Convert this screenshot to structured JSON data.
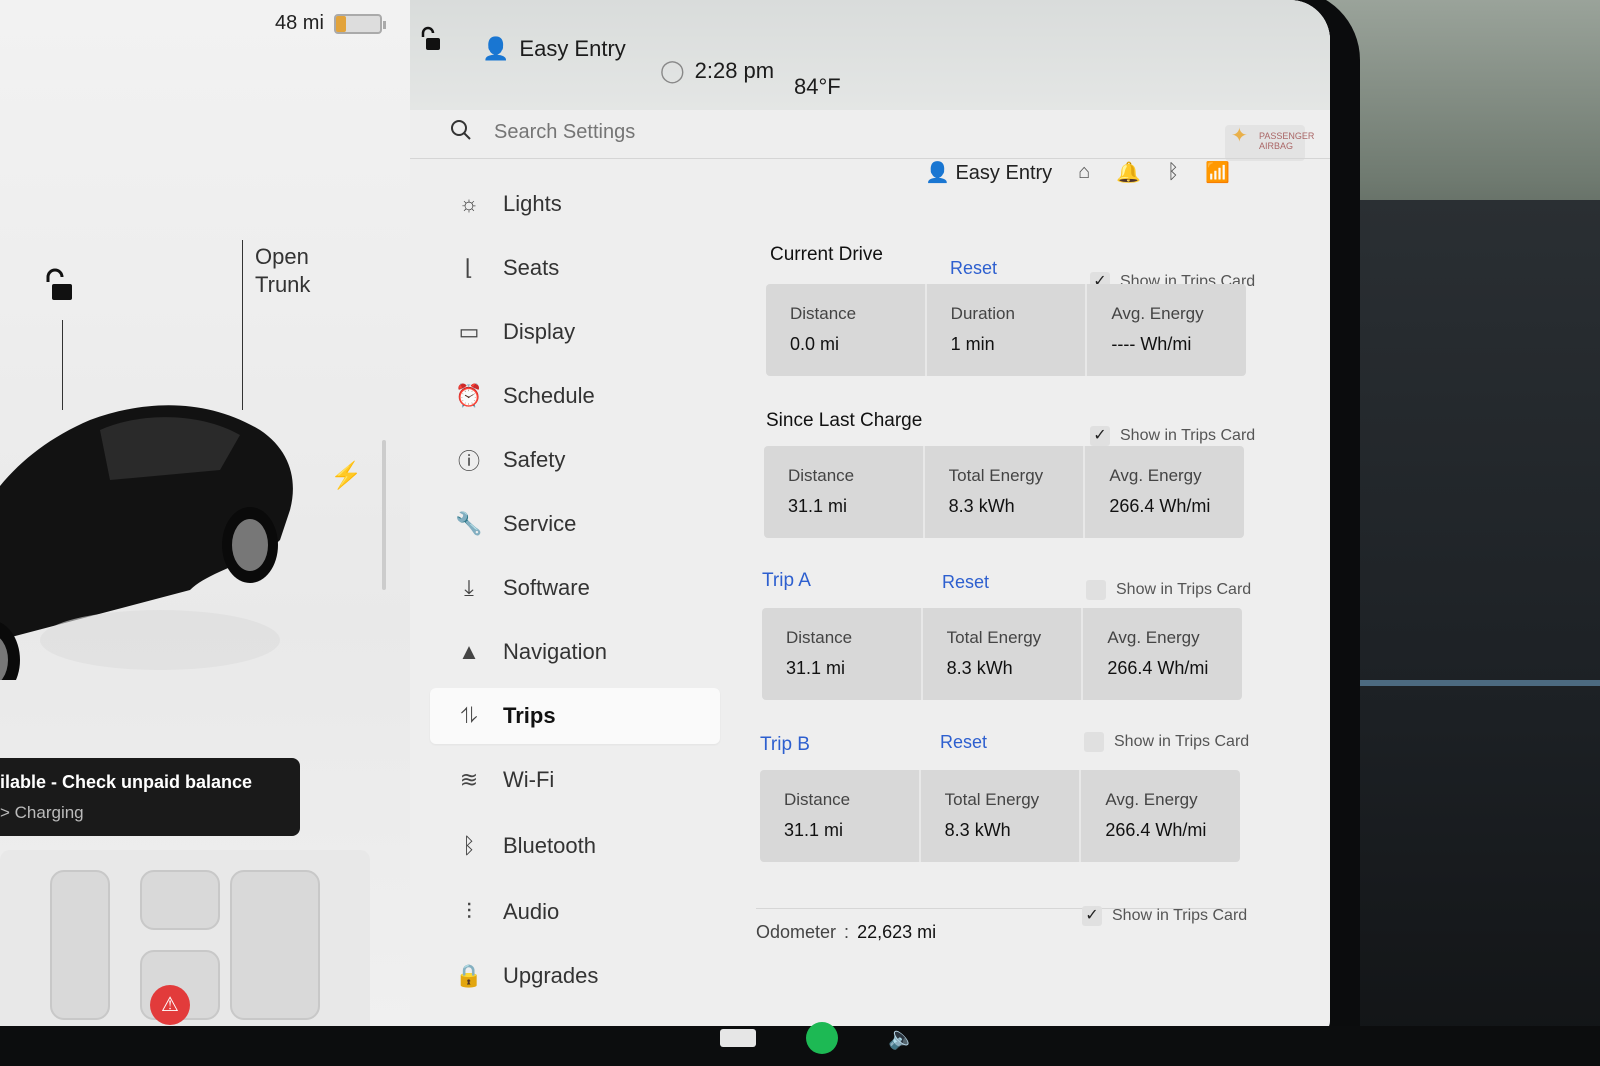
{
  "status": {
    "range": "48 mi",
    "profile": "Easy Entry",
    "time": "2:28 pm",
    "temperature": "84°F"
  },
  "airbag": {
    "text": "PASSENGER AIRBAG"
  },
  "car": {
    "open_trunk_line1": "Open",
    "open_trunk_line2": "Trunk",
    "notice_title": "ilable - Check unpaid balance",
    "notice_sub": "> Charging"
  },
  "search": {
    "placeholder": "Search Settings"
  },
  "menu": [
    {
      "label": "Lights",
      "icon": "sun-icon"
    },
    {
      "label": "Seats",
      "icon": "seat-icon"
    },
    {
      "label": "Display",
      "icon": "display-icon"
    },
    {
      "label": "Schedule",
      "icon": "alarm-clock-icon"
    },
    {
      "label": "Safety",
      "icon": "exclamation-circle-icon"
    },
    {
      "label": "Service",
      "icon": "wrench-icon"
    },
    {
      "label": "Software",
      "icon": "download-icon"
    },
    {
      "label": "Navigation",
      "icon": "navigation-arrow-icon"
    },
    {
      "label": "Trips",
      "icon": "trips-icon",
      "active": true
    },
    {
      "label": "Wi-Fi",
      "icon": "wifi-icon"
    },
    {
      "label": "Bluetooth",
      "icon": "bluetooth-icon"
    },
    {
      "label": "Audio",
      "icon": "sliders-icon"
    },
    {
      "label": "Upgrades",
      "icon": "bag-icon"
    }
  ],
  "panel": {
    "profile": "Easy Entry",
    "show_label": "Show in Trips Card",
    "reset_label": "Reset",
    "current_drive": {
      "title": "Current Drive",
      "checked": true,
      "stats": [
        {
          "label": "Distance",
          "value": "0.0 mi"
        },
        {
          "label": "Duration",
          "value": "1 min"
        },
        {
          "label": "Avg. Energy",
          "value": "---- Wh/mi"
        }
      ]
    },
    "since_last_charge": {
      "title": "Since Last Charge",
      "checked": true,
      "stats": [
        {
          "label": "Distance",
          "value": "31.1 mi"
        },
        {
          "label": "Total Energy",
          "value": "8.3 kWh"
        },
        {
          "label": "Avg. Energy",
          "value": "266.4 Wh/mi"
        }
      ]
    },
    "trip_a": {
      "title": "Trip A",
      "checked": false,
      "stats": [
        {
          "label": "Distance",
          "value": "31.1 mi"
        },
        {
          "label": "Total Energy",
          "value": "8.3 kWh"
        },
        {
          "label": "Avg. Energy",
          "value": "266.4 Wh/mi"
        }
      ]
    },
    "trip_b": {
      "title": "Trip B",
      "checked": false,
      "stats": [
        {
          "label": "Distance",
          "value": "31.1 mi"
        },
        {
          "label": "Total Energy",
          "value": "8.3 kWh"
        },
        {
          "label": "Avg. Energy",
          "value": "266.4 Wh/mi"
        }
      ]
    },
    "odometer": {
      "label": "Odometer",
      "value": "22,623 mi",
      "checked": true
    }
  },
  "colors": {
    "accent": "#2d5fcf",
    "battery": "#e2a33b",
    "alert": "#e23b3b"
  }
}
